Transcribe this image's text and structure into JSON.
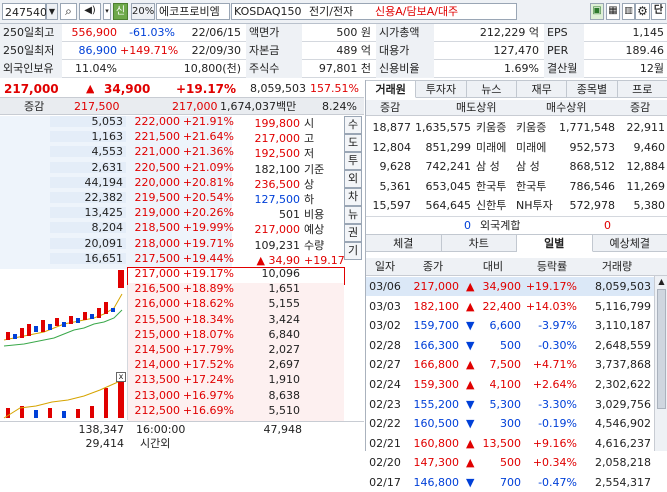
{
  "topbar": {
    "code": "247540",
    "credit_badge": "신",
    "margin": "20%",
    "stock_name": "에코프로비엠",
    "market": "KOSDAQ150",
    "sector": "전기/전자",
    "tags": "신용A/담보A/대주",
    "buy_btn": "단"
  },
  "info": {
    "row1": {
      "l1": "250일최고",
      "v1": "556,900",
      "p1": "-61.03%",
      "d1": "22/06/15",
      "l2": "액면가",
      "v2": "500 원",
      "l3": "시가총액",
      "v3": "212,229 억",
      "l4": "EPS",
      "v4": "1,145"
    },
    "row2": {
      "l1": "250일최저",
      "v1": "86,900",
      "p1": "+149.71%",
      "d1": "22/09/30",
      "l2": "자본금",
      "v2": "489 억",
      "l3": "대용가",
      "v3": "127,470",
      "l4": "PER",
      "v4": "189.46"
    },
    "row3": {
      "l1": "외국인보유",
      "v1": "11.04%",
      "v1b": "10,800(천)",
      "l2": "주식수",
      "v2": "97,801 천",
      "l3": "신용비율",
      "v3": "1.69%",
      "l4": "결산월",
      "v4": "12월"
    }
  },
  "pricebar": {
    "price": "217,000",
    "arrow": "▲",
    "change": "34,900",
    "rate": "+19.17%",
    "volume": "8,059,503",
    "vol_pct": "157.51%"
  },
  "orderbook": {
    "header": {
      "label": "증감",
      "price": "217,500",
      "price2": "217,000",
      "amount": "1,674,037백만",
      "pct": "8.24%"
    },
    "asks": [
      {
        "qty": "5,053",
        "price": "222,000",
        "rate": "+21.91%"
      },
      {
        "qty": "1,163",
        "price": "221,500",
        "rate": "+21.64%"
      },
      {
        "qty": "4,553",
        "price": "221,000",
        "rate": "+21.36%"
      },
      {
        "qty": "2,631",
        "price": "220,500",
        "rate": "+21.09%"
      },
      {
        "qty": "44,194",
        "price": "220,000",
        "rate": "+20.81%"
      },
      {
        "qty": "22,382",
        "price": "219,500",
        "rate": "+20.54%"
      },
      {
        "qty": "13,425",
        "price": "219,000",
        "rate": "+20.26%"
      },
      {
        "qty": "8,204",
        "price": "218,500",
        "rate": "+19.99%"
      },
      {
        "qty": "20,091",
        "price": "218,000",
        "rate": "+19.71%"
      },
      {
        "qty": "16,651",
        "price": "217,500",
        "rate": "+19.44%"
      }
    ],
    "bids": [
      {
        "qty": "10,096",
        "price": "217,000",
        "rate": "+19.17%"
      },
      {
        "qty": "1,651",
        "price": "216,500",
        "rate": "+18.89%"
      },
      {
        "qty": "5,155",
        "price": "216,000",
        "rate": "+18.62%"
      },
      {
        "qty": "3,424",
        "price": "215,500",
        "rate": "+18.34%"
      },
      {
        "qty": "6,840",
        "price": "215,000",
        "rate": "+18.07%"
      },
      {
        "qty": "2,027",
        "price": "214,500",
        "rate": "+17.79%"
      },
      {
        "qty": "2,697",
        "price": "214,000",
        "rate": "+17.52%"
      },
      {
        "qty": "1,910",
        "price": "213,500",
        "rate": "+17.24%"
      },
      {
        "qty": "8,638",
        "price": "213,000",
        "rate": "+16.97%"
      },
      {
        "qty": "5,510",
        "price": "212,500",
        "rate": "+16.69%"
      }
    ],
    "summary": [
      {
        "val": "199,800",
        "lbl": "시",
        "cls": "r"
      },
      {
        "val": "217,000",
        "lbl": "고",
        "cls": "r"
      },
      {
        "val": "192,500",
        "lbl": "저",
        "cls": "r"
      },
      {
        "val": "182,100",
        "lbl": "기준",
        "cls": "k"
      },
      {
        "val": "236,500",
        "lbl": "상",
        "cls": "r"
      },
      {
        "val": "127,500",
        "lbl": "하",
        "cls": "b"
      },
      {
        "val": "501",
        "lbl": "비용",
        "cls": "k"
      },
      {
        "val": "217,000",
        "lbl": "예상",
        "cls": "r"
      },
      {
        "val": "109,231",
        "lbl": "수량",
        "cls": "k"
      },
      {
        "val": "▲ 34,90",
        "lbl": "+19.17%",
        "cls": "r"
      }
    ],
    "footer": {
      "ask_total": "138,347",
      "bid_total": "29,414",
      "time": "16:00:00",
      "time_label": "시간외",
      "bid_sum": "47,948"
    },
    "side_tabs": [
      "수",
      "도",
      "투",
      "외",
      "차",
      "뉴",
      "권",
      "기"
    ],
    "close_x": "x"
  },
  "right": {
    "tabs1": [
      {
        "label": "거래원",
        "on": true
      },
      {
        "label": "투자자"
      },
      {
        "label": "뉴스"
      },
      {
        "label": "재무"
      },
      {
        "label": "종목별"
      },
      {
        "label": "프로"
      }
    ],
    "broker_header": {
      "c1": "증감",
      "c2": "매도상위",
      "c3": "매수상위",
      "c4": "증감"
    },
    "brokers": [
      {
        "d1": "18,877",
        "sv": "1,635,575",
        "sn": "키움증",
        "bn": "키움증",
        "bv": "1,771,548",
        "d2": "22,911"
      },
      {
        "d1": "12,804",
        "sv": "851,299",
        "sn": "미래에",
        "bn": "미래에",
        "bv": "952,573",
        "d2": "9,460"
      },
      {
        "d1": "9,628",
        "sv": "742,241",
        "sn": "삼 성",
        "bn": "삼 성",
        "bv": "868,512",
        "d2": "12,884"
      },
      {
        "d1": "5,361",
        "sv": "653,045",
        "sn": "한국투",
        "bn": "한국투",
        "bv": "786,546",
        "d2": "11,269"
      },
      {
        "d1": "15,597",
        "sv": "564,645",
        "sn": "신한투",
        "bn": "NH투자",
        "bv": "572,978",
        "d2": "5,380"
      }
    ],
    "foreign": {
      "left": "0",
      "label": "외국계합",
      "right": "0"
    },
    "tabs2": [
      {
        "label": "체결"
      },
      {
        "label": "차트"
      },
      {
        "label": "일별",
        "on": true
      },
      {
        "label": "예상체결"
      }
    ],
    "daily_header": [
      "일자",
      "종가",
      "대비",
      "등락률",
      "거래량"
    ],
    "daily": [
      {
        "date": "03/06",
        "close": "217,000",
        "arrow": "▲",
        "diff": "34,900",
        "rate": "+19.17%",
        "vol": "8,059,503",
        "c": "r"
      },
      {
        "date": "03/03",
        "close": "182,100",
        "arrow": "▲",
        "diff": "22,400",
        "rate": "+14.03%",
        "vol": "5,116,799",
        "c": "r"
      },
      {
        "date": "03/02",
        "close": "159,700",
        "arrow": "▼",
        "diff": "6,600",
        "rate": "-3.97%",
        "vol": "3,110,187",
        "c": "b"
      },
      {
        "date": "02/28",
        "close": "166,300",
        "arrow": "▼",
        "diff": "500",
        "rate": "-0.30%",
        "vol": "2,648,559",
        "c": "b"
      },
      {
        "date": "02/27",
        "close": "166,800",
        "arrow": "▲",
        "diff": "7,500",
        "rate": "+4.71%",
        "vol": "3,737,868",
        "c": "r"
      },
      {
        "date": "02/24",
        "close": "159,300",
        "arrow": "▲",
        "diff": "4,100",
        "rate": "+2.64%",
        "vol": "2,302,622",
        "c": "r"
      },
      {
        "date": "02/23",
        "close": "155,200",
        "arrow": "▼",
        "diff": "5,300",
        "rate": "-3.30%",
        "vol": "3,029,756",
        "c": "b"
      },
      {
        "date": "02/22",
        "close": "160,500",
        "arrow": "▼",
        "diff": "300",
        "rate": "-0.19%",
        "vol": "4,546,902",
        "c": "b"
      },
      {
        "date": "02/21",
        "close": "160,800",
        "arrow": "▲",
        "diff": "13,500",
        "rate": "+9.16%",
        "vol": "4,616,237",
        "c": "r"
      },
      {
        "date": "02/20",
        "close": "147,300",
        "arrow": "▲",
        "diff": "500",
        "rate": "+0.34%",
        "vol": "2,058,218",
        "c": "r"
      },
      {
        "date": "02/17",
        "close": "146,800",
        "arrow": "▼",
        "diff": "700",
        "rate": "-0.47%",
        "vol": "2,554,317",
        "c": "b"
      }
    ]
  }
}
